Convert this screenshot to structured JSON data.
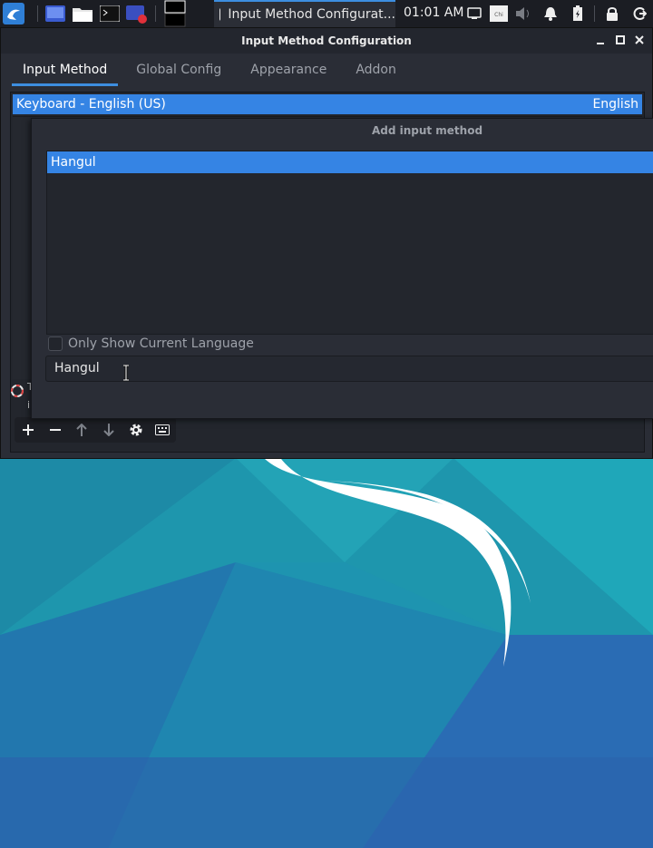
{
  "taskbar": {
    "task_title": "Input Method Configurat...",
    "clock": "01:01 AM",
    "colors": {
      "panel": "#1b1d23",
      "accent": "#3d8ee0"
    }
  },
  "window": {
    "title": "Input Method Configuration",
    "tabs": [
      {
        "label": "Input Method",
        "active": true
      },
      {
        "label": "Global Config",
        "active": false
      },
      {
        "label": "Appearance",
        "active": false
      },
      {
        "label": "Addon",
        "active": false
      }
    ],
    "input_methods": [
      {
        "name": "Keyboard - English (US)",
        "language": "English",
        "selected": true
      }
    ],
    "info_text_fragment": "T\ni"
  },
  "dialog": {
    "title": "Add input method",
    "list": [
      {
        "label": "Hangul",
        "selected": true
      }
    ],
    "only_show_current_language": {
      "label": "Only Show Current Language",
      "checked": false
    },
    "search": {
      "value": "Hangul"
    }
  },
  "toolbar": {
    "icons": [
      "add-icon",
      "remove-icon",
      "move-up-icon",
      "move-down-icon",
      "settings-icon",
      "keyboard-icon"
    ]
  },
  "colors": {
    "selection": "#3584e4",
    "window_bg": "#2a2d36"
  }
}
